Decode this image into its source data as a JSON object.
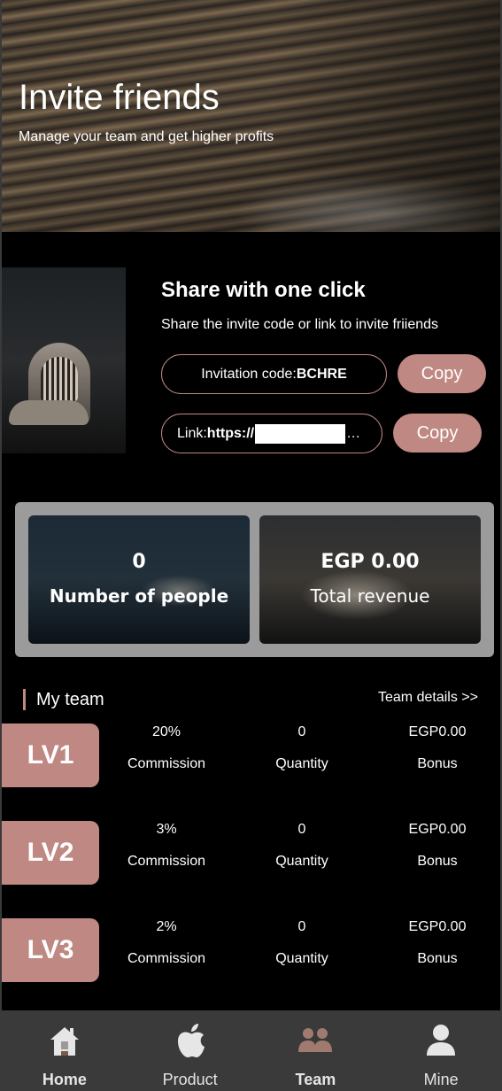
{
  "hero": {
    "title": "Invite friends",
    "subtitle": "Manage your team and get higher profits"
  },
  "share": {
    "title": "Share with one click",
    "description": "Share the invite code or link to invite friiends",
    "code_label": "Invitation code: ",
    "code_value": "BCHRE",
    "link_label": "Link: ",
    "link_value": "https://",
    "link_ellipsis": "…",
    "copy_label": "Copy"
  },
  "stats": {
    "people_value": "0",
    "people_label": "Number of people",
    "revenue_value": "EGP 0.00",
    "revenue_label": "Total revenue"
  },
  "team": {
    "title": "My team",
    "details_link": "Team details >>",
    "levels": [
      {
        "badge": "LV1",
        "commission": "20%",
        "commission_label": "Commission",
        "quantity": "0",
        "quantity_label": "Quantity",
        "bonus": "EGP0.00",
        "bonus_label": "Bonus"
      },
      {
        "badge": "LV2",
        "commission": "3%",
        "commission_label": "Commission",
        "quantity": "0",
        "quantity_label": "Quantity",
        "bonus": "EGP0.00",
        "bonus_label": "Bonus"
      },
      {
        "badge": "LV3",
        "commission": "2%",
        "commission_label": "Commission",
        "quantity": "0",
        "quantity_label": "Quantity",
        "bonus": "EGP0.00",
        "bonus_label": "Bonus"
      }
    ]
  },
  "nav": {
    "items": [
      {
        "label": "Home",
        "icon": "home-icon"
      },
      {
        "label": "Product",
        "icon": "apple-icon"
      },
      {
        "label": "Team",
        "icon": "team-icon"
      },
      {
        "label": "Mine",
        "icon": "user-icon"
      }
    ]
  },
  "colors": {
    "accent": "#c08882",
    "background": "#000000",
    "nav_background": "#3a3a3a",
    "stats_panel": "#9b9b9b"
  }
}
